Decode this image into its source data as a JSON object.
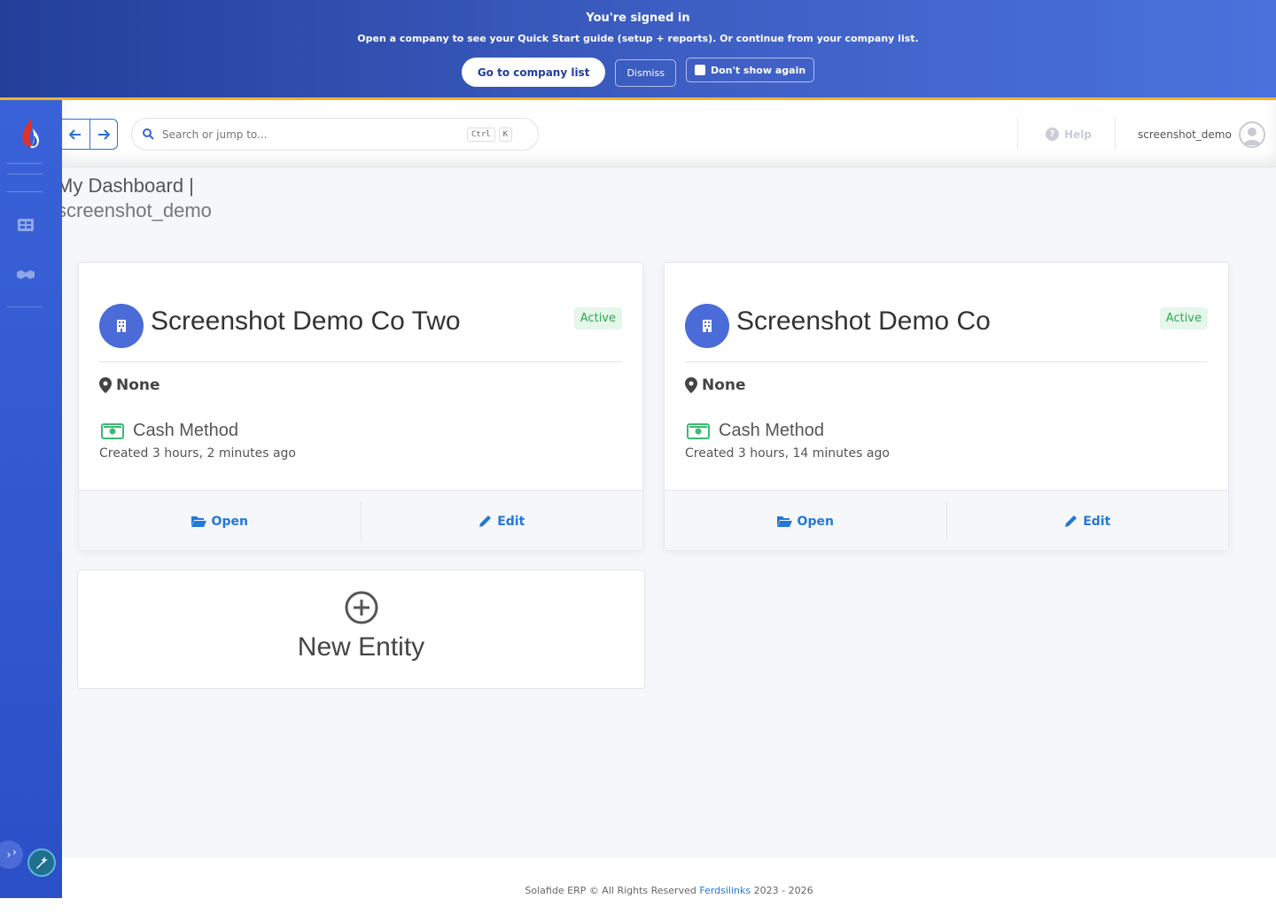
{
  "banner": {
    "title": "You're signed in",
    "subtitle": "Open a company to see your Quick Start guide (setup + reports). Or continue from your company list.",
    "go_button": "Go to company list",
    "dismiss_button": "Dismiss",
    "dont_show_label": "Don't show again"
  },
  "header": {
    "search_placeholder": "Search or jump to...",
    "shortcut_ctrl": "Ctrl",
    "shortcut_k": "K",
    "help_label": "Help",
    "username": "screenshot_demo"
  },
  "page": {
    "title": "My Dashboard |",
    "subtitle": "screenshot_demo"
  },
  "entities": [
    {
      "name": "Screenshot Demo Co Two",
      "status": "Active",
      "location": "None",
      "method": "Cash Method",
      "created": "Created 3 hours, 2 minutes ago",
      "open_label": "Open",
      "edit_label": "Edit"
    },
    {
      "name": "Screenshot Demo Co",
      "status": "Active",
      "location": "None",
      "method": "Cash Method",
      "created": "Created 3 hours, 14 minutes ago",
      "open_label": "Open",
      "edit_label": "Edit"
    }
  ],
  "new_entity_label": "New Entity",
  "footer": {
    "prefix": "Solafide ERP © All Rights Reserved ",
    "link": "Ferdsilinks",
    "suffix": " 2023 - 2026"
  },
  "icons": {
    "logo": "flame-logo-icon",
    "sidebar": [
      "dashboard-grid-icon",
      "handshake-icon"
    ],
    "search": "search-icon",
    "help": "question-circle-icon",
    "avatar": "user-avatar-icon",
    "entity": "building-icon",
    "location": "map-marker-icon",
    "method": "money-bill-icon",
    "open": "folder-open-icon",
    "edit": "pencil-icon",
    "new": "plus-circle-icon"
  },
  "colors": {
    "primary": "#4a6bd8",
    "link": "#2478d6",
    "active_badge_bg": "#e5f6ea",
    "active_badge_text": "#2eaa4f",
    "banner_accent": "#f0b429",
    "money_icon": "#3cba6f"
  }
}
